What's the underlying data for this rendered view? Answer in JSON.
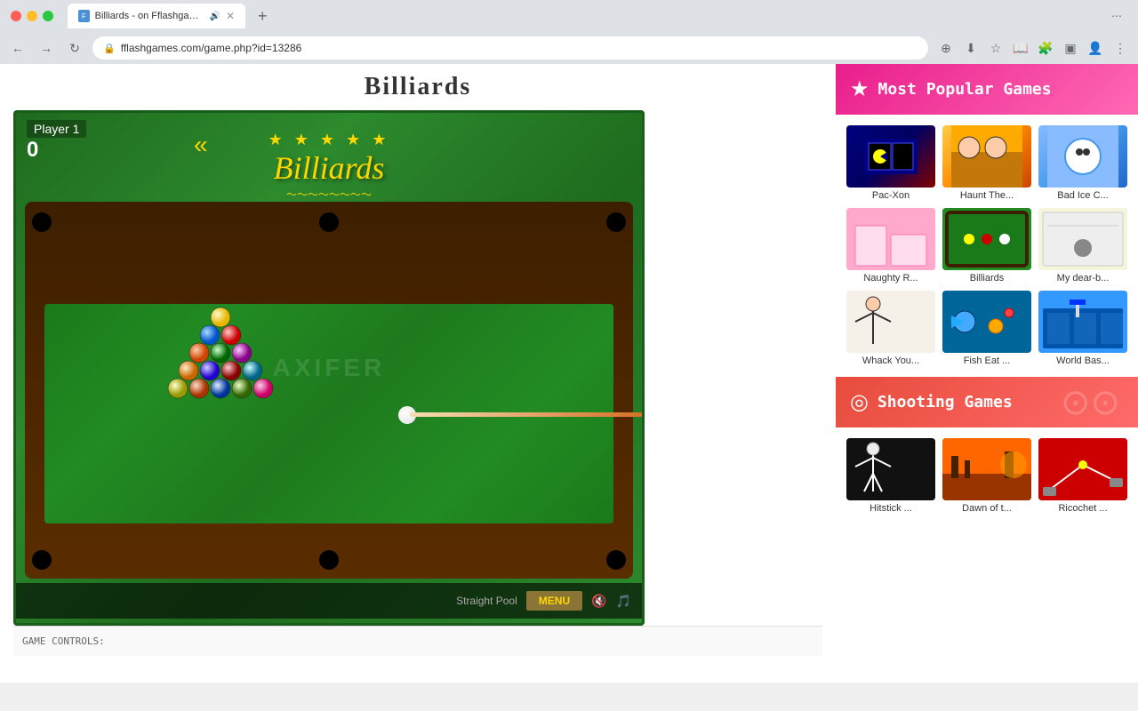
{
  "browser": {
    "tab_title": "Billiards - on Fflashgames...",
    "url": "fflashgames.com/game.php?id=13286",
    "new_tab_label": "+",
    "nav": {
      "back": "←",
      "forward": "→",
      "refresh": "↻"
    }
  },
  "page": {
    "title": "Billiards"
  },
  "game": {
    "player_label": "Player 1",
    "score": "0",
    "logo_stars": "★ ★ ★ ★ ★",
    "logo_text": "Billiards",
    "chevron": "«",
    "mode": "Straight Pool",
    "menu_label": "MENU",
    "watermark": "AXIFER",
    "controls_label": "GAME CONTROLS:"
  },
  "sidebar": {
    "popular_title": "Most Popular Games",
    "popular_star": "★",
    "shooting_title": "Shooting Games",
    "shooting_icon": "◎",
    "popular_games": [
      {
        "label": "Pac-Xon",
        "thumb_class": "thumb-pacxon"
      },
      {
        "label": "Haunt The...",
        "thumb_class": "thumb-haunt"
      },
      {
        "label": "Bad Ice C...",
        "thumb_class": "thumb-badice"
      },
      {
        "label": "Naughty R...",
        "thumb_class": "thumb-naughty"
      },
      {
        "label": "Billiards",
        "thumb_class": "thumb-billiards"
      },
      {
        "label": "My dear-b...",
        "thumb_class": "thumb-mydear"
      },
      {
        "label": "Whack You...",
        "thumb_class": "thumb-whack"
      },
      {
        "label": "Fish Eat ...",
        "thumb_class": "thumb-fisheat"
      },
      {
        "label": "World Bas...",
        "thumb_class": "thumb-worldbas"
      }
    ],
    "shooting_games": [
      {
        "label": "Hitstick ...",
        "thumb_class": "thumb-hitstick"
      },
      {
        "label": "Dawn of t...",
        "thumb_class": "thumb-dawn"
      },
      {
        "label": "Ricochet ...",
        "thumb_class": "thumb-ricochet"
      }
    ]
  }
}
